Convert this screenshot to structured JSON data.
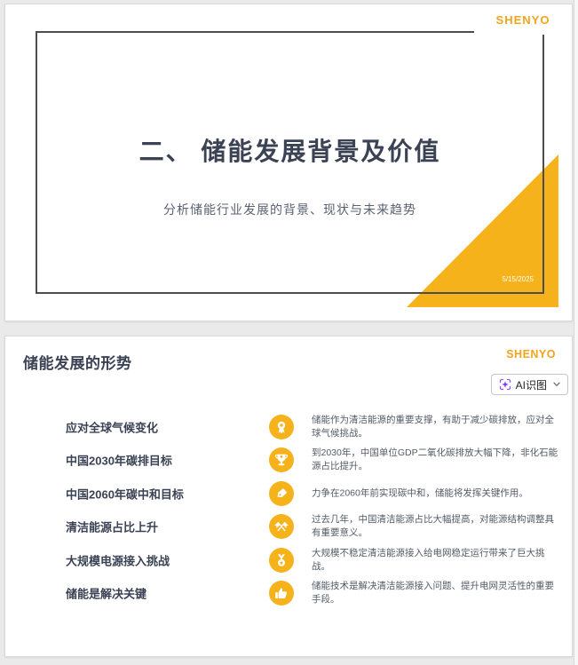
{
  "theme": {
    "accent": "#F5B21B",
    "logo_color": "#F2A41B",
    "dark_text": "#3A4254",
    "ai_icon_purple": "#7C3AED"
  },
  "slide1": {
    "logo": "SHENYO",
    "title": "二、 储能发展背景及价值",
    "subtitle": "分析储能行业发展的背景、现状与未来趋势",
    "date": "5/15/2025"
  },
  "slide2": {
    "logo": "SHENYO",
    "title": "储能发展的形势",
    "ai_button": {
      "label": "AI识图"
    },
    "items": [
      {
        "icon": "award-icon",
        "label": "应对全球气候变化",
        "desc": "储能作为清洁能源的重要支撑，有助于减少碳排放，应对全球气候挑战。"
      },
      {
        "icon": "trophy-icon",
        "label": "中国2030年碳排目标",
        "desc": "到2030年，中国单位GDP二氧化碳排放大幅下降，非化石能源占比提升。"
      },
      {
        "icon": "tag-icon",
        "label": "中国2060年碳中和目标",
        "desc": "力争在2060年前实现碳中和，储能将发挥关键作用。"
      },
      {
        "icon": "crossed-flags-icon",
        "label": "清洁能源占比上升",
        "desc": "过去几年，中国清洁能源占比大幅提高，对能源结构调整具有重要意义。"
      },
      {
        "icon": "medal-icon",
        "label": "大规模电源接入挑战",
        "desc": "大规模不稳定清洁能源接入给电网稳定运行带来了巨大挑战。"
      },
      {
        "icon": "thumbs-up-icon",
        "label": "储能是解决关键",
        "desc": "储能技术是解决清洁能源接入问题、提升电网灵活性的重要手段。"
      }
    ]
  }
}
